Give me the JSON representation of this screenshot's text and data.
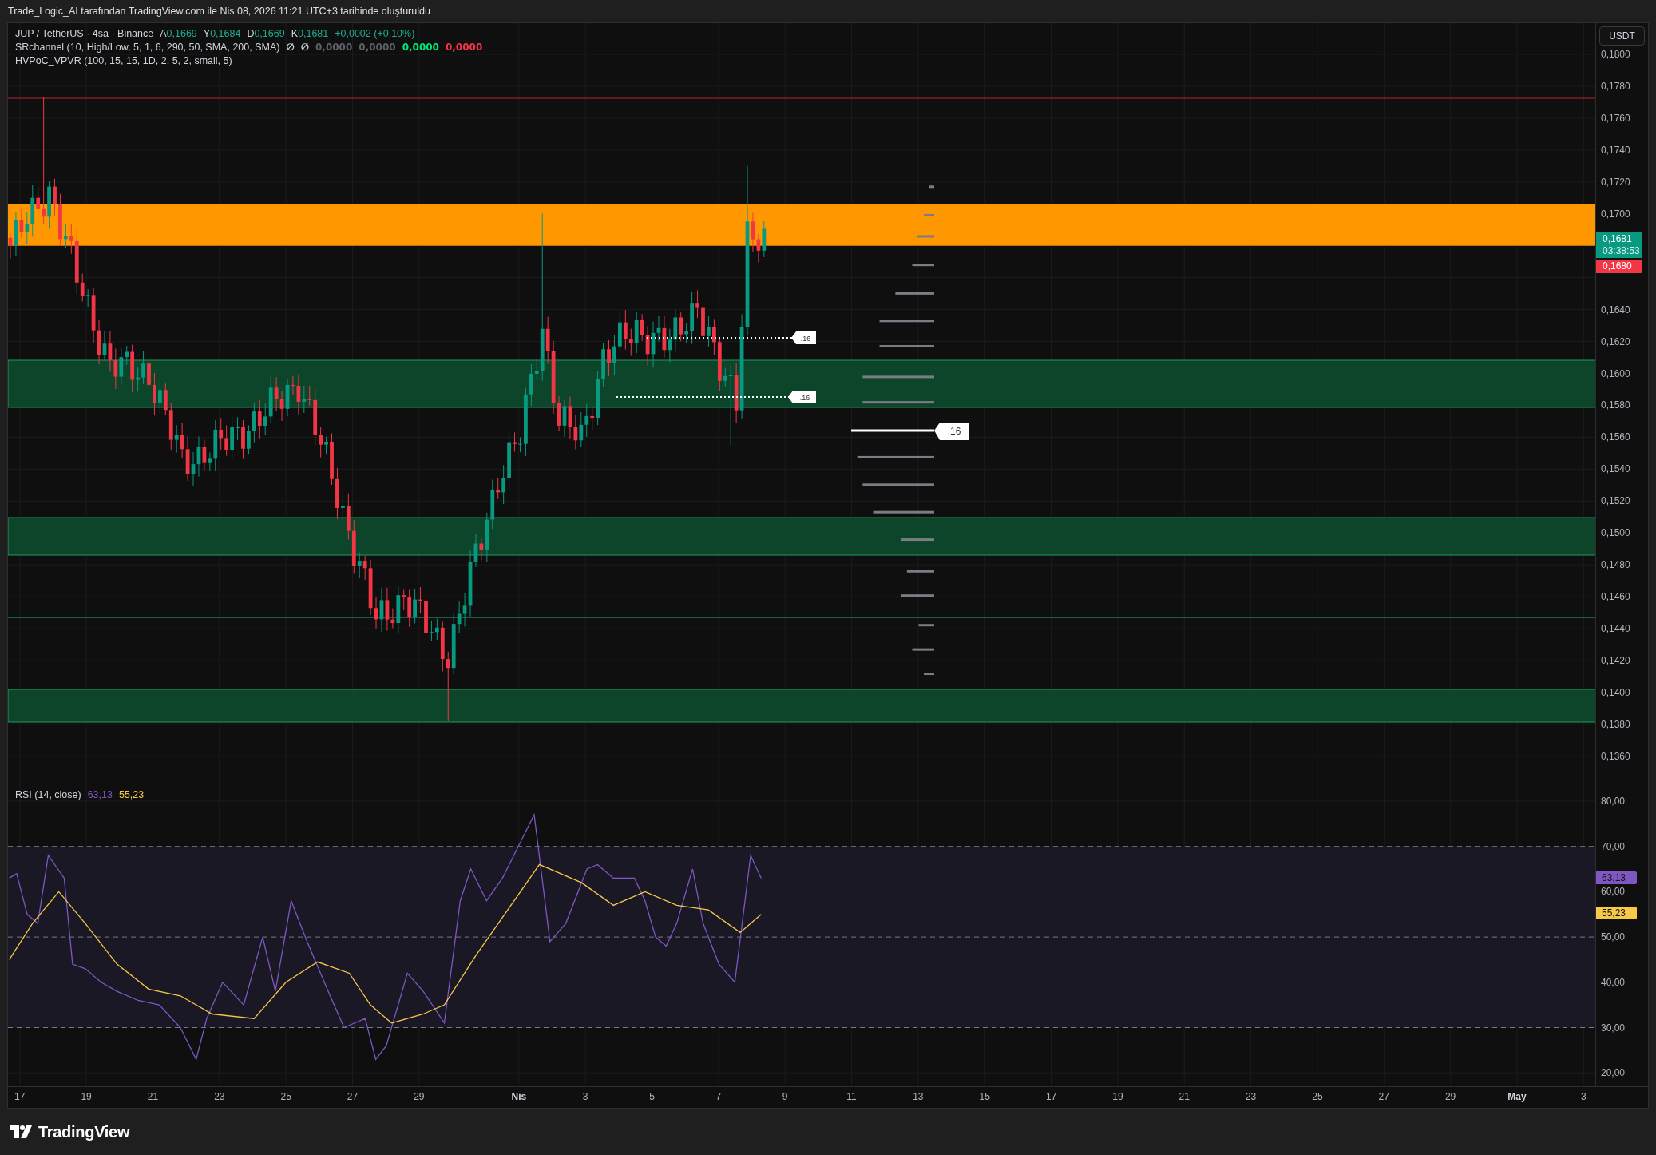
{
  "header": {
    "caption": "Trade_Logic_AI tarafından TradingView.com ile Nis 08, 2026 11:21 UTC+3 tarihinde oluşturuldu"
  },
  "legend": {
    "symbol": "JUP / TetherUS · 4sa · Binance",
    "ohlc": [
      {
        "label": "A",
        "value": "0,1669"
      },
      {
        "label": "Y",
        "value": "0,1684"
      },
      {
        "label": "D",
        "value": "0,1669"
      },
      {
        "label": "K",
        "value": "0,1681"
      }
    ],
    "change": "+0,0002 (+0,10%)",
    "indicators": [
      {
        "text": "SRchannel (10, High/Low, 5, 1, 6, 290, 50, SMA, 200, SMA)",
        "values": [
          {
            "text": "∅",
            "color": "#d1d4dc"
          },
          {
            "text": "∅",
            "color": "#d1d4dc"
          },
          {
            "text": "0,0000",
            "color": "#5d606b"
          },
          {
            "text": "0,0000",
            "color": "#5d606b"
          },
          {
            "text": "0,0000",
            "color": "#00e676"
          },
          {
            "text": "0,0000",
            "color": "#f23645"
          }
        ]
      },
      {
        "text": "HVPoC_VPVR (100, 15, 15, 1D, 2, 5, 2, small, 5)"
      }
    ]
  },
  "level_labels": [
    ".16",
    ".16",
    ".16"
  ],
  "price_axis": {
    "unit_button": "USDT",
    "ticks_upper": [
      "0,1800",
      "0,1780",
      "0,1760",
      "0,1740",
      "0,1720",
      "0,1700"
    ],
    "ticks_lower": [
      "0,1640",
      "0,1620",
      "0,1600",
      "0,1580",
      "0,1560",
      "0,1540",
      "0,1520",
      "0,1500",
      "0,1480",
      "0,1460",
      "0,1440",
      "0,1420",
      "0,1400",
      "0,1380",
      "0,1360"
    ],
    "badges": [
      {
        "text": "0,1681",
        "subtext": "03:38:53",
        "color": "#089981"
      },
      {
        "text": "0,1680",
        "color": "#f23645"
      }
    ]
  },
  "rsi": {
    "title": "RSI (14, close)",
    "values": [
      {
        "text": "63,13",
        "color": "#7e57c2"
      },
      {
        "text": "55,23",
        "color": "#f7c948"
      }
    ],
    "ticks": [
      "80,00",
      "70,00",
      "60,00",
      "50,00",
      "40,00",
      "30,00",
      "20,00"
    ],
    "badges": [
      {
        "text": "63,13",
        "color": "#7e57c2"
      },
      {
        "text": "55,23",
        "color": "#f7c948"
      }
    ]
  },
  "time_axis": {
    "ticks": [
      {
        "label": "17",
        "kind": "day"
      },
      {
        "label": "19",
        "kind": "day"
      },
      {
        "label": "21",
        "kind": "day"
      },
      {
        "label": "23",
        "kind": "day"
      },
      {
        "label": "25",
        "kind": "day"
      },
      {
        "label": "27",
        "kind": "day"
      },
      {
        "label": "29",
        "kind": "day"
      },
      {
        "label": "Nis",
        "kind": "month"
      },
      {
        "label": "3",
        "kind": "day"
      },
      {
        "label": "5",
        "kind": "day"
      },
      {
        "label": "7",
        "kind": "day"
      },
      {
        "label": "9",
        "kind": "day"
      },
      {
        "label": "11",
        "kind": "day"
      },
      {
        "label": "13",
        "kind": "day"
      },
      {
        "label": "15",
        "kind": "day"
      },
      {
        "label": "17",
        "kind": "day"
      },
      {
        "label": "19",
        "kind": "day"
      },
      {
        "label": "21",
        "kind": "day"
      },
      {
        "label": "23",
        "kind": "day"
      },
      {
        "label": "25",
        "kind": "day"
      },
      {
        "label": "27",
        "kind": "day"
      },
      {
        "label": "29",
        "kind": "day"
      },
      {
        "label": "May",
        "kind": "month"
      },
      {
        "label": "3",
        "kind": "day"
      }
    ]
  },
  "footer": {
    "logo": "TradingView"
  }
}
